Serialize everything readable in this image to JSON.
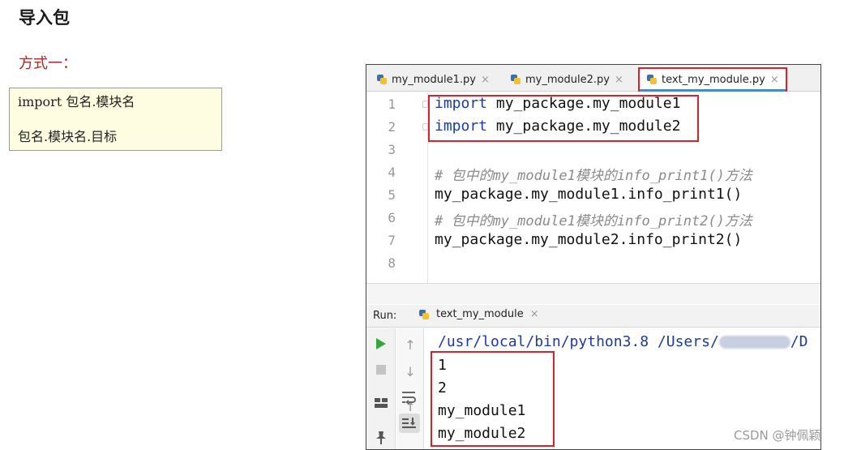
{
  "doc": {
    "heading": "导入包",
    "subheading": "方式一：",
    "code_lines": [
      "import 包名.模块名",
      "包名.模块名.目标"
    ]
  },
  "editor": {
    "tabs": [
      {
        "label": "my_module1.py",
        "close": "×",
        "active": false
      },
      {
        "label": "my_module2.py",
        "close": "×",
        "active": false
      },
      {
        "label": "text_my_module.py",
        "close": "×",
        "active": true
      }
    ],
    "line_numbers": [
      "1",
      "2",
      "3",
      "4",
      "5",
      "6",
      "7",
      "8"
    ],
    "lines": [
      {
        "keyword": "import",
        "rest": " my_package.my_module1"
      },
      {
        "keyword": "import",
        "rest": " my_package.my_module2"
      },
      {
        "text": ""
      },
      {
        "comment": "# 包中的my_module1模块的info_print1()方法"
      },
      {
        "text": "my_package.my_module1.info_print1()"
      },
      {
        "comment": "# 包中的my_module1模块的info_print2()方法"
      },
      {
        "text": "my_package.my_module2.info_print2()"
      },
      {
        "text": ""
      }
    ]
  },
  "run": {
    "label": "Run:",
    "config": "text_my_module",
    "close": "×",
    "console_path_prefix": "/usr/local/bin/python3.8 /Users/",
    "console_path_suffix": "/D",
    "output": [
      "1",
      "2",
      "my_module1",
      "my_module2"
    ]
  },
  "icons": {
    "run": "play-icon",
    "stop": "stop-icon",
    "up": "arrow-up-icon",
    "down": "arrow-down-icon",
    "wrap": "soft-wrap-icon",
    "scroll_end": "scroll-to-end-icon",
    "layout": "layout-icon",
    "pin": "pin-icon"
  },
  "colors": {
    "highlight": "#d9212a",
    "keyword": "#1b3aa6",
    "doc_subheading": "#a52a2a",
    "code_box_bg": "#fffde1"
  },
  "watermark": "CSDN @钟佩颖"
}
